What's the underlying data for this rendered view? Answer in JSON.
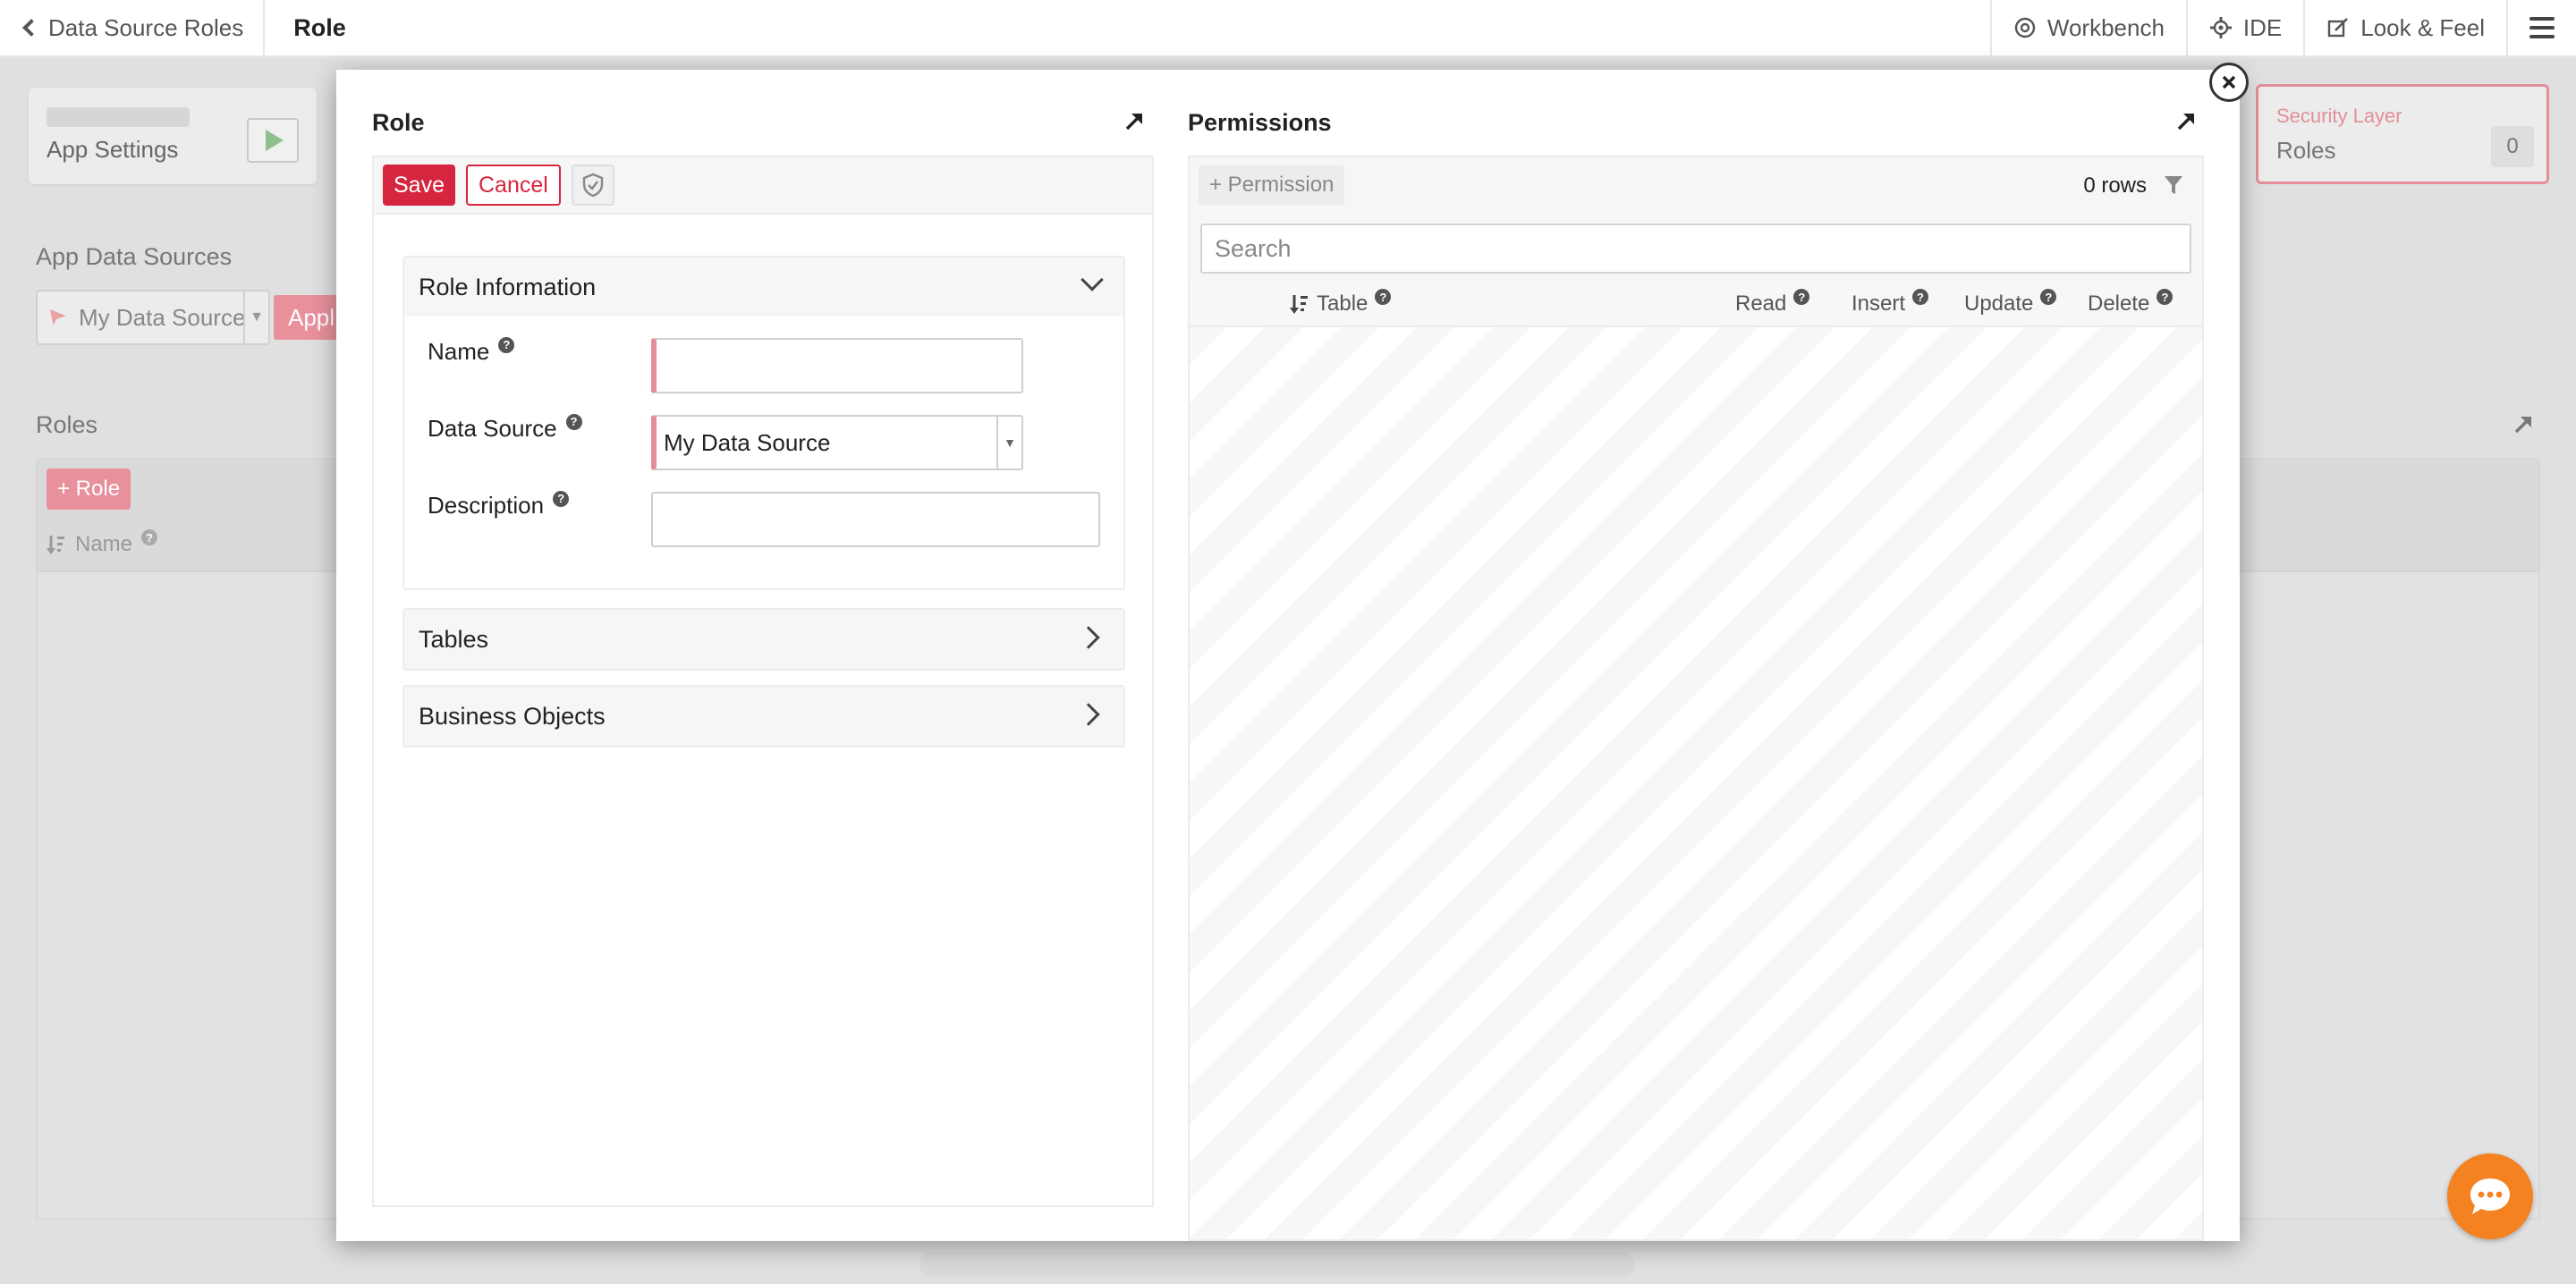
{
  "topbar": {
    "back_label": "Data Source Roles",
    "current": "Role",
    "nav": [
      {
        "label": "Workbench",
        "icon": "workbench-icon"
      },
      {
        "label": "IDE",
        "icon": "gear-icon"
      },
      {
        "label": "Look & Feel",
        "icon": "look-feel-icon"
      }
    ]
  },
  "background": {
    "app_settings": "App Settings",
    "app_data_sources": "App Data Sources",
    "data_source_value": "My Data Source",
    "apply_label": "Appl",
    "roles_title": "Roles",
    "add_role": "+ Role",
    "roles_col_name": "Name",
    "security_layer": {
      "title": "Security Layer",
      "value": "Roles",
      "count": "0"
    }
  },
  "role_pane": {
    "title": "Role",
    "save": "Save",
    "cancel": "Cancel",
    "sections": {
      "role_info": "Role Information",
      "tables": "Tables",
      "business_objects": "Business Objects"
    },
    "fields": {
      "name_label": "Name",
      "name_value": "",
      "data_source_label": "Data Source",
      "data_source_value": "My Data Source",
      "description_label": "Description",
      "description_value": ""
    }
  },
  "permissions_pane": {
    "title": "Permissions",
    "add_permission": "+ Permission",
    "row_count": "0 rows",
    "search_placeholder": "Search",
    "columns": {
      "table": "Table",
      "read": "Read",
      "insert": "Insert",
      "update": "Update",
      "delete": "Delete"
    }
  },
  "colors": {
    "accent": "#d6263f",
    "accent_light": "#e38e99",
    "chat": "#f58220"
  }
}
